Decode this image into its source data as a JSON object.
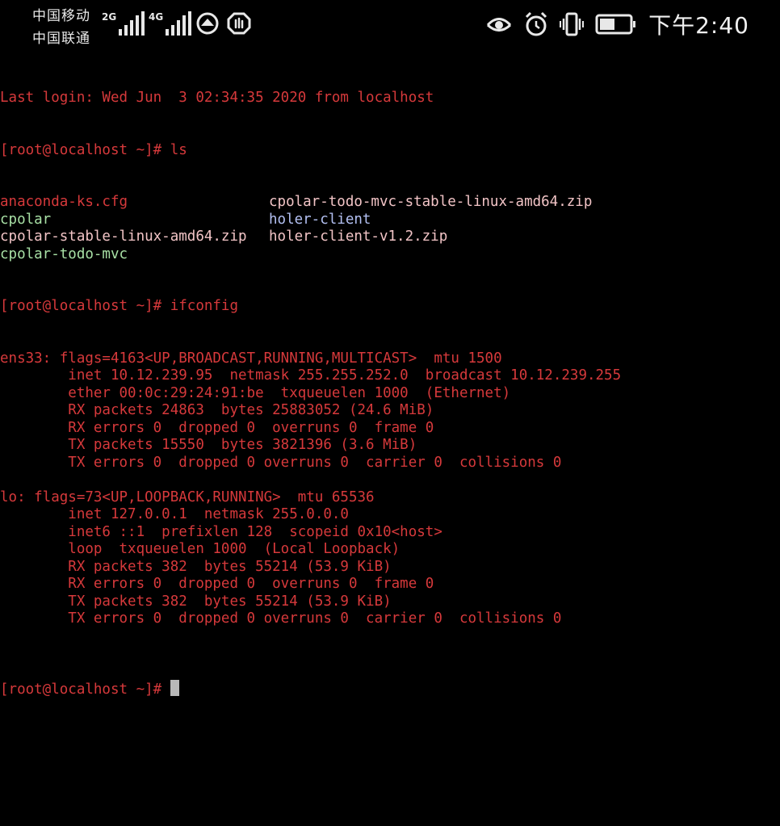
{
  "status_bar": {
    "carrier_1": "中国移动",
    "carrier_2": "中国联通",
    "net_1": "2G",
    "net_2": "4G",
    "time": "下午2:40",
    "icons": [
      "signal-2g-icon",
      "signal-4g-icon",
      "app-circle-icon",
      "shield-icon",
      "eye-icon",
      "alarm-icon",
      "vibrate-icon",
      "battery-icon"
    ]
  },
  "terminal": {
    "last_login": "Last login: Wed Jun  3 02:34:35 2020 from localhost",
    "prompt": "[root@localhost ~]# ",
    "cmd_ls": "ls",
    "ls_rows": [
      {
        "left": "anaconda-ks.cfg",
        "left_color": "red",
        "right": "cpolar-todo-mvc-stable-linux-amd64.zip",
        "right_color": "pink"
      },
      {
        "left": "cpolar",
        "left_color": "green",
        "right": "holer-client",
        "right_color": "blue"
      },
      {
        "left": "cpolar-stable-linux-amd64.zip",
        "left_color": "pink",
        "right": "holer-client-v1.2.zip",
        "right_color": "pink"
      },
      {
        "left": "cpolar-todo-mvc",
        "left_color": "green",
        "right": "",
        "right_color": "pink"
      }
    ],
    "cmd_ifconfig": "ifconfig",
    "ifconfig_output": [
      "ens33: flags=4163<UP,BROADCAST,RUNNING,MULTICAST>  mtu 1500",
      "        inet 10.12.239.95  netmask 255.255.252.0  broadcast 10.12.239.255",
      "        ether 00:0c:29:24:91:be  txqueuelen 1000  (Ethernet)",
      "        RX packets 24863  bytes 25883052 (24.6 MiB)",
      "        RX errors 0  dropped 0  overruns 0  frame 0",
      "        TX packets 15550  bytes 3821396 (3.6 MiB)",
      "        TX errors 0  dropped 0 overruns 0  carrier 0  collisions 0",
      "",
      "lo: flags=73<UP,LOOPBACK,RUNNING>  mtu 65536",
      "        inet 127.0.0.1  netmask 255.0.0.0",
      "        inet6 ::1  prefixlen 128  scopeid 0x10<host>",
      "        loop  txqueuelen 1000  (Local Loopback)",
      "        RX packets 382  bytes 55214 (53.9 KiB)",
      "        RX errors 0  dropped 0  overruns 0  frame 0",
      "        TX packets 382  bytes 55214 (53.9 KiB)",
      "        TX errors 0  dropped 0 overruns 0  carrier 0  collisions 0",
      ""
    ],
    "final_prompt": "[root@localhost ~]# "
  },
  "colors": {
    "background": "#000000",
    "red": "#d6393b",
    "pink": "#f2c4c6",
    "green": "#a8e0a5",
    "blue": "#b3c0f2",
    "cursor": "#b8b8b8"
  }
}
